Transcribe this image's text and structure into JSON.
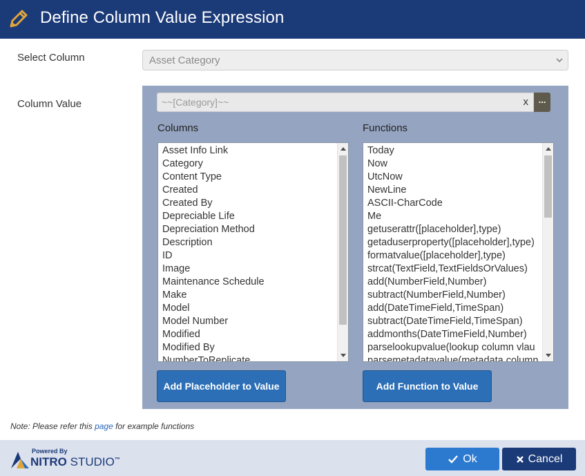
{
  "dialog": {
    "title": "Define Column Value Expression"
  },
  "form": {
    "select_column_label": "Select Column",
    "select_column_value": "Asset Category",
    "column_value_label": "Column Value",
    "expression_value": "~~[Category]~~",
    "clear_label": "x",
    "more_label": "..."
  },
  "columns": {
    "label": "Columns",
    "items": [
      "Asset Info Link",
      "Category",
      "Content Type",
      "Created",
      "Created By",
      "Depreciable Life",
      "Depreciation Method",
      "Description",
      "ID",
      "Image",
      "Maintenance Schedule",
      "Make",
      "Model",
      "Model Number",
      "Modified",
      "Modified By",
      "NumberToReplicate"
    ],
    "add_button_label": "Add Placeholder to Value"
  },
  "functions": {
    "label": "Functions",
    "items": [
      "Today",
      "Now",
      "UtcNow",
      "NewLine",
      "ASCII-CharCode",
      "Me",
      "getuserattr([placeholder],type)",
      "getaduserproperty([placeholder],type)",
      "formatvalue([placeholder],type)",
      "strcat(TextField,TextFieldsOrValues)",
      "add(NumberField,Number)",
      "subtract(NumberField,Number)",
      "add(DateTimeField,TimeSpan)",
      "subtract(DateTimeField,TimeSpan)",
      "addmonths(DateTimeField,Number)",
      "parselookupvalue(lookup column vlau",
      "parsemetadatavalue(metadata column"
    ],
    "add_button_label": "Add Function to Value"
  },
  "note": {
    "prefix": "Note: Please refer this ",
    "link": "page",
    "suffix": " for example functions"
  },
  "footer": {
    "powered_by": "Powered By",
    "brand_nitro": "NITRO",
    "brand_studio": " STUDIO",
    "trademark": "™",
    "ok_label": "Ok",
    "cancel_label": "Cancel"
  },
  "colors": {
    "header_bg": "#1b3a78",
    "panel_bg": "#95a5c1",
    "button_blue": "#2c6fb7",
    "footer_bg": "#dce1ee",
    "pencil": "#e0a53a"
  }
}
